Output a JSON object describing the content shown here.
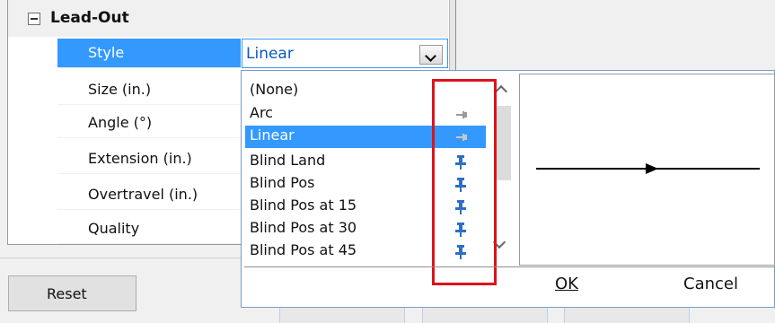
{
  "group": {
    "label": "Lead-Out"
  },
  "properties": [
    {
      "label": "Style",
      "value": "Linear"
    },
    {
      "label": "Size (in.)"
    },
    {
      "label": "Angle (°)"
    },
    {
      "label": "Extension (in.)"
    },
    {
      "label": "Overtravel (in.)"
    },
    {
      "label": "Quality"
    }
  ],
  "dropdown": {
    "options": [
      {
        "name": "(None)",
        "pin": "none"
      },
      {
        "name": "Arc",
        "pin": "pin-gray-icon"
      },
      {
        "name": "Linear",
        "pin": "pin-gray-icon"
      },
      {
        "name": "Blind Land",
        "pin": "pin-blue-icon"
      },
      {
        "name": "Blind Pos",
        "pin": "pin-blue-icon"
      },
      {
        "name": "Blind Pos at 15",
        "pin": "pin-blue-icon"
      },
      {
        "name": "Blind Pos at 30",
        "pin": "pin-blue-icon"
      },
      {
        "name": "Blind Pos at 45",
        "pin": "pin-blue-icon"
      }
    ],
    "selected": "Linear",
    "ok_label": "OK",
    "cancel_label": "Cancel"
  },
  "buttons": {
    "reset_label": "Reset"
  },
  "colors": {
    "selection": "#3399ff",
    "highlight_box": "#e0121c",
    "pin_blue": "#2f6fc4",
    "pin_gray": "#9a9a9a"
  }
}
